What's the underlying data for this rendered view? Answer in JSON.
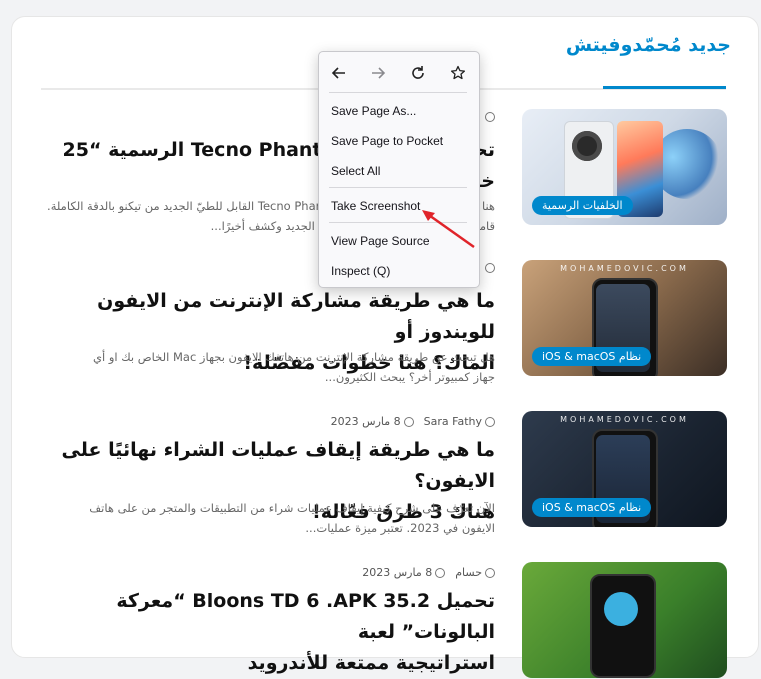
{
  "section": {
    "title": "جديد مُحمّدوفيتش"
  },
  "watermark": "MOHAMEDOVIC.COM",
  "posts": [
    {
      "category": "الخلفيات الرسمية",
      "title_line1": "تحميل خلفيات Tecno Phantom الرسمية “25",
      "title_line2": "خلفية” للهاتف",
      "excerpt_line1": "هنا يمكنك تحميل خلفيات هاتف Tecno Phantom القابل للطيّ الجديد من تيكنو بالدقة الكاملة.",
      "excerpt_line2": "قامت شركة تيكنو بالكشف عن هاتفها الجديد وكشف أخيرًا..."
    },
    {
      "category": "نظام iOS & macOS",
      "title_line1": "ما هي طريقة مشاركة الإنترنت من الايفون للويندوز أو",
      "title_line2": "الماك؟ هنا خطوات مفصّلة!",
      "excerpt_line1": "هل تبحث عن طريقة مشاركة الإنترنت من هاتفك الايفون بجهاز Mac الخاص بك او أي",
      "excerpt_line2": "جهاز كمبيوتر أخر؟ يبحث الكثيرون..."
    },
    {
      "author": "Sara Fathy",
      "date": "8 مارس 2023",
      "category": "نظام iOS & macOS",
      "title_line1": "ما هي طريقة إيقاف عمليات الشراء نهائيًا على الايفون؟",
      "title_line2": "هناك 3 طرق فعّالة!",
      "excerpt_line1": "الآن تعرّف على شرح كيفية إيقاف عمليات شراء من التطبيقات والمتجر من على هاتف",
      "excerpt_line2": "الايفون في 2023. تعتبر ميزة عمليات..."
    },
    {
      "author": "حسام",
      "date": "8 مارس 2023",
      "title_line1": "تحميل Bloons TD 6 .APK 35.2 “معركة البالونات” لعبة",
      "title_line2": "استراتيجية ممتعة للأندرويد"
    }
  ],
  "context_menu": {
    "items": [
      {
        "label": "Save Page As..."
      },
      {
        "label": "Save Page to Pocket"
      },
      {
        "label": "Select All"
      },
      {
        "label": "Take Screenshot"
      },
      {
        "label": "View Page Source"
      },
      {
        "label": "Inspect (Q)"
      }
    ]
  },
  "colors": {
    "accent": "#0088cc",
    "arrow": "#e0242a"
  },
  "icons": [
    "back-arrow-icon",
    "forward-arrow-icon",
    "reload-icon",
    "bookmark-star-icon",
    "user-icon",
    "clock-icon"
  ]
}
